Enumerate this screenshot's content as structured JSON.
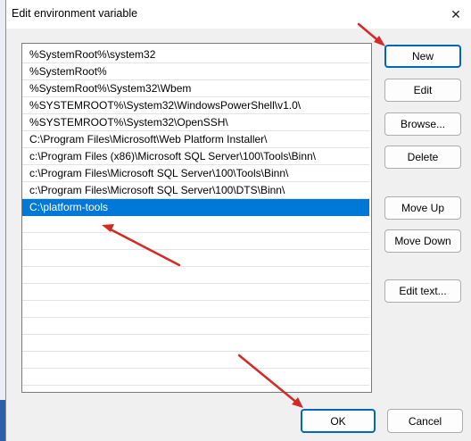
{
  "dialog": {
    "title": "Edit environment variable",
    "close_label": "✕"
  },
  "list": {
    "items": [
      "%SystemRoot%\\system32",
      "%SystemRoot%",
      "%SystemRoot%\\System32\\Wbem",
      "%SYSTEMROOT%\\System32\\WindowsPowerShell\\v1.0\\",
      "%SYSTEMROOT%\\System32\\OpenSSH\\",
      "C:\\Program Files\\Microsoft\\Web Platform Installer\\",
      "c:\\Program Files (x86)\\Microsoft SQL Server\\100\\Tools\\Binn\\",
      "c:\\Program Files\\Microsoft SQL Server\\100\\Tools\\Binn\\",
      "c:\\Program Files\\Microsoft SQL Server\\100\\DTS\\Binn\\",
      "C:\\platform-tools"
    ],
    "selected_index": 9
  },
  "buttons": {
    "new": "New",
    "edit": "Edit",
    "browse": "Browse...",
    "delete": "Delete",
    "move_up": "Move Up",
    "move_down": "Move Down",
    "edit_text": "Edit text...",
    "ok": "OK",
    "cancel": "Cancel"
  },
  "colors": {
    "selection": "#0078d7",
    "annotation_arrow": "#d42a26",
    "default_button_border": "#0067c0"
  }
}
